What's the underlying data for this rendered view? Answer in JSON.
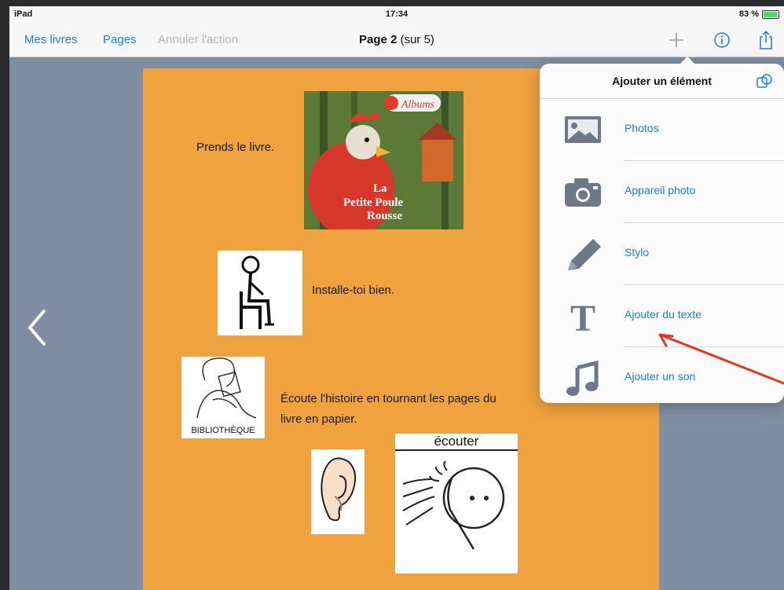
{
  "status_bar": {
    "device": "iPad",
    "time": "17:34",
    "battery": "83 %",
    "battery_level": 0.83
  },
  "nav": {
    "my_books": "Mes livres",
    "pages": "Pages",
    "undo": "Annuler l'action",
    "title_bold": "Page 2",
    "title_rest": "(sur 5)",
    "icons": [
      "plus-icon",
      "info-icon",
      "share-icon"
    ]
  },
  "page": {
    "text1": "Prends le livre.",
    "text2": "Installe-toi bien.",
    "text3_line1": "Écoute l'histoire en tournant les pages du",
    "text3_line2": "livre en papier.",
    "cover": {
      "brand": "Albums",
      "title_line1": "La",
      "title_line2": "Petite Poule",
      "title_line3": "Rousse"
    },
    "picto_library_label": "BIBLIOTHÈQUE",
    "picto_listen_label": "écouter",
    "background_color": "#f0a23e"
  },
  "popover": {
    "title": "Ajouter un élément",
    "items": [
      {
        "label": "Photos",
        "icon": "photo-icon"
      },
      {
        "label": "Appareil photo",
        "icon": "camera-icon"
      },
      {
        "label": "Stylo",
        "icon": "pencil-icon"
      },
      {
        "label": "Ajouter du texte",
        "icon": "text-icon"
      },
      {
        "label": "Ajouter un son",
        "icon": "music-note-icon"
      }
    ]
  },
  "colors": {
    "accent": "#1a7ee6",
    "annotation": "#e8341c",
    "icon_gray": "#6e7887"
  }
}
